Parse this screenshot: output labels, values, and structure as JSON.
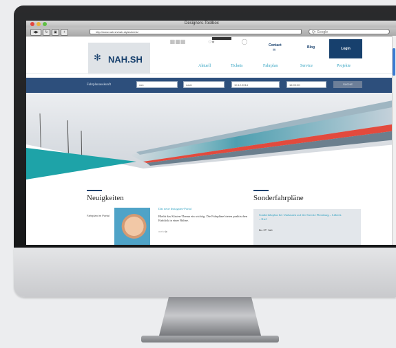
{
  "browser": {
    "window_title": "Designers-Toolbox",
    "url": "http://www.nah.sh/nah-stylesheets/",
    "search_placeholder": "Q• Google"
  },
  "site": {
    "logo_text": "NAH.SH",
    "top": {
      "contact": "Contact",
      "blog": "Blog",
      "login": "Login"
    },
    "nav": [
      "Aktuell",
      "Tickets",
      "Fahrplan",
      "Service",
      "Projekte"
    ],
    "search_band": {
      "label": "Fahrplanauskunft",
      "from": "von",
      "to": "nach",
      "date": "10.12.2014",
      "time": "16:00:00",
      "button": "SUCHE"
    },
    "news": {
      "heading": "Neuigkeiten",
      "side_label": "Fahrplan im Portal",
      "title": "Das neue Instagram-Portal",
      "text": "Bleibt das Küsten-Thema ein wichtig. Die Fahrpläne bieten praktischen Einblick in einer Bühne.",
      "more": "mehr ▶"
    },
    "sonder": {
      "heading": "Sonderfahrpläne",
      "link": "Sonderfahrplan bei Umbauten auf der Strecke Flensburg – Lübeck – Kiel",
      "date": "bis 27. Juli"
    }
  },
  "colors": {
    "brand": "#17406d",
    "accent": "#2a9fbf",
    "teal": "#1ea3a8"
  }
}
